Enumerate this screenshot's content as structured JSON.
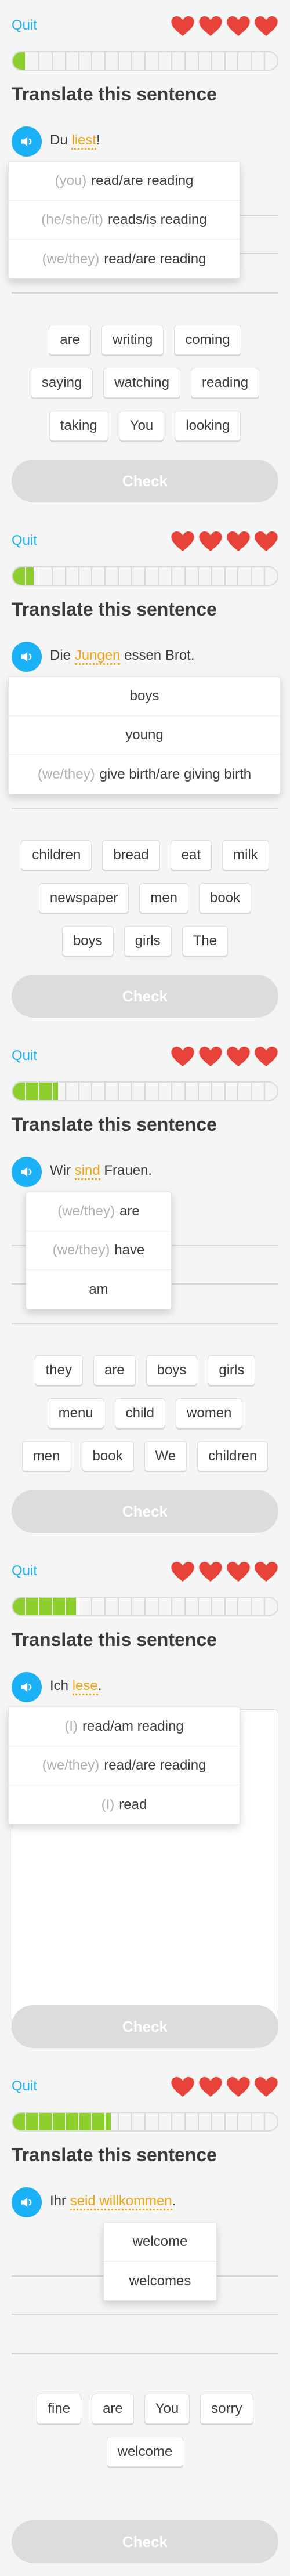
{
  "screens": [
    {
      "quit": "Quit",
      "progress": 0.05,
      "title": "Translate this sentence",
      "sentence": {
        "before": "Du ",
        "highlight": "liest",
        "after": "!"
      },
      "popup": [
        {
          "prefix": "(you)",
          "text": "read/are reading"
        },
        {
          "prefix": "(he/she/it)",
          "text": "reads/is reading"
        },
        {
          "prefix": "(we/they)",
          "text": "read/are reading"
        }
      ],
      "word_bank": [
        [
          "are",
          "writing",
          "coming"
        ],
        [
          "saying",
          "watching",
          "reading"
        ],
        [
          "taking",
          "You",
          "looking"
        ]
      ],
      "check": "Check"
    },
    {
      "quit": "Quit",
      "progress": 0.08,
      "title": "Translate this sentence",
      "sentence": {
        "before": "Die ",
        "highlight": "Jungen",
        "after": " essen Brot."
      },
      "popup": [
        {
          "prefix": "",
          "text": "boys"
        },
        {
          "prefix": "",
          "text": "young"
        },
        {
          "prefix": "(we/they)",
          "text": "give birth/are giving birth"
        }
      ],
      "word_bank": [
        [
          "children",
          "bread",
          "eat",
          "milk"
        ],
        [
          "newspaper",
          "men",
          "book"
        ],
        [
          "boys",
          "girls",
          "The"
        ]
      ],
      "check": "Check"
    },
    {
      "quit": "Quit",
      "progress": 0.17,
      "title": "Translate this sentence",
      "sentence": {
        "before": "Wir ",
        "highlight": "sind",
        "after": " Frauen."
      },
      "popup": [
        {
          "prefix": "(we/they)",
          "text": "are"
        },
        {
          "prefix": "(we/they)",
          "text": "have"
        },
        {
          "prefix": "",
          "text": "am"
        }
      ],
      "word_bank": [
        [
          "they",
          "are",
          "boys",
          "girls"
        ],
        [
          "menu",
          "child",
          "women"
        ],
        [
          "men",
          "book",
          "We",
          "children"
        ]
      ],
      "check": "Check"
    },
    {
      "quit": "Quit",
      "progress": 0.24,
      "title": "Translate this sentence",
      "sentence": {
        "before": "Ich ",
        "highlight": "lese",
        "after": "."
      },
      "popup": [
        {
          "prefix": "(I)",
          "text": "read/am reading"
        },
        {
          "prefix": "(we/they)",
          "text": "read/are reading"
        },
        {
          "prefix": "(I)",
          "text": "read"
        }
      ],
      "word_bank": [],
      "check": "Check"
    },
    {
      "quit": "Quit",
      "progress": 0.37,
      "title": "Translate this sentence",
      "sentence": {
        "before": "Ihr ",
        "highlight": "seid willkommen",
        "after": "."
      },
      "popup": [
        {
          "prefix": "",
          "text": "welcome"
        },
        {
          "prefix": "",
          "text": "welcomes"
        }
      ],
      "word_bank": [
        [
          "fine",
          "are",
          "You",
          "sorry"
        ],
        [
          "welcome"
        ]
      ],
      "check": "Check"
    }
  ]
}
